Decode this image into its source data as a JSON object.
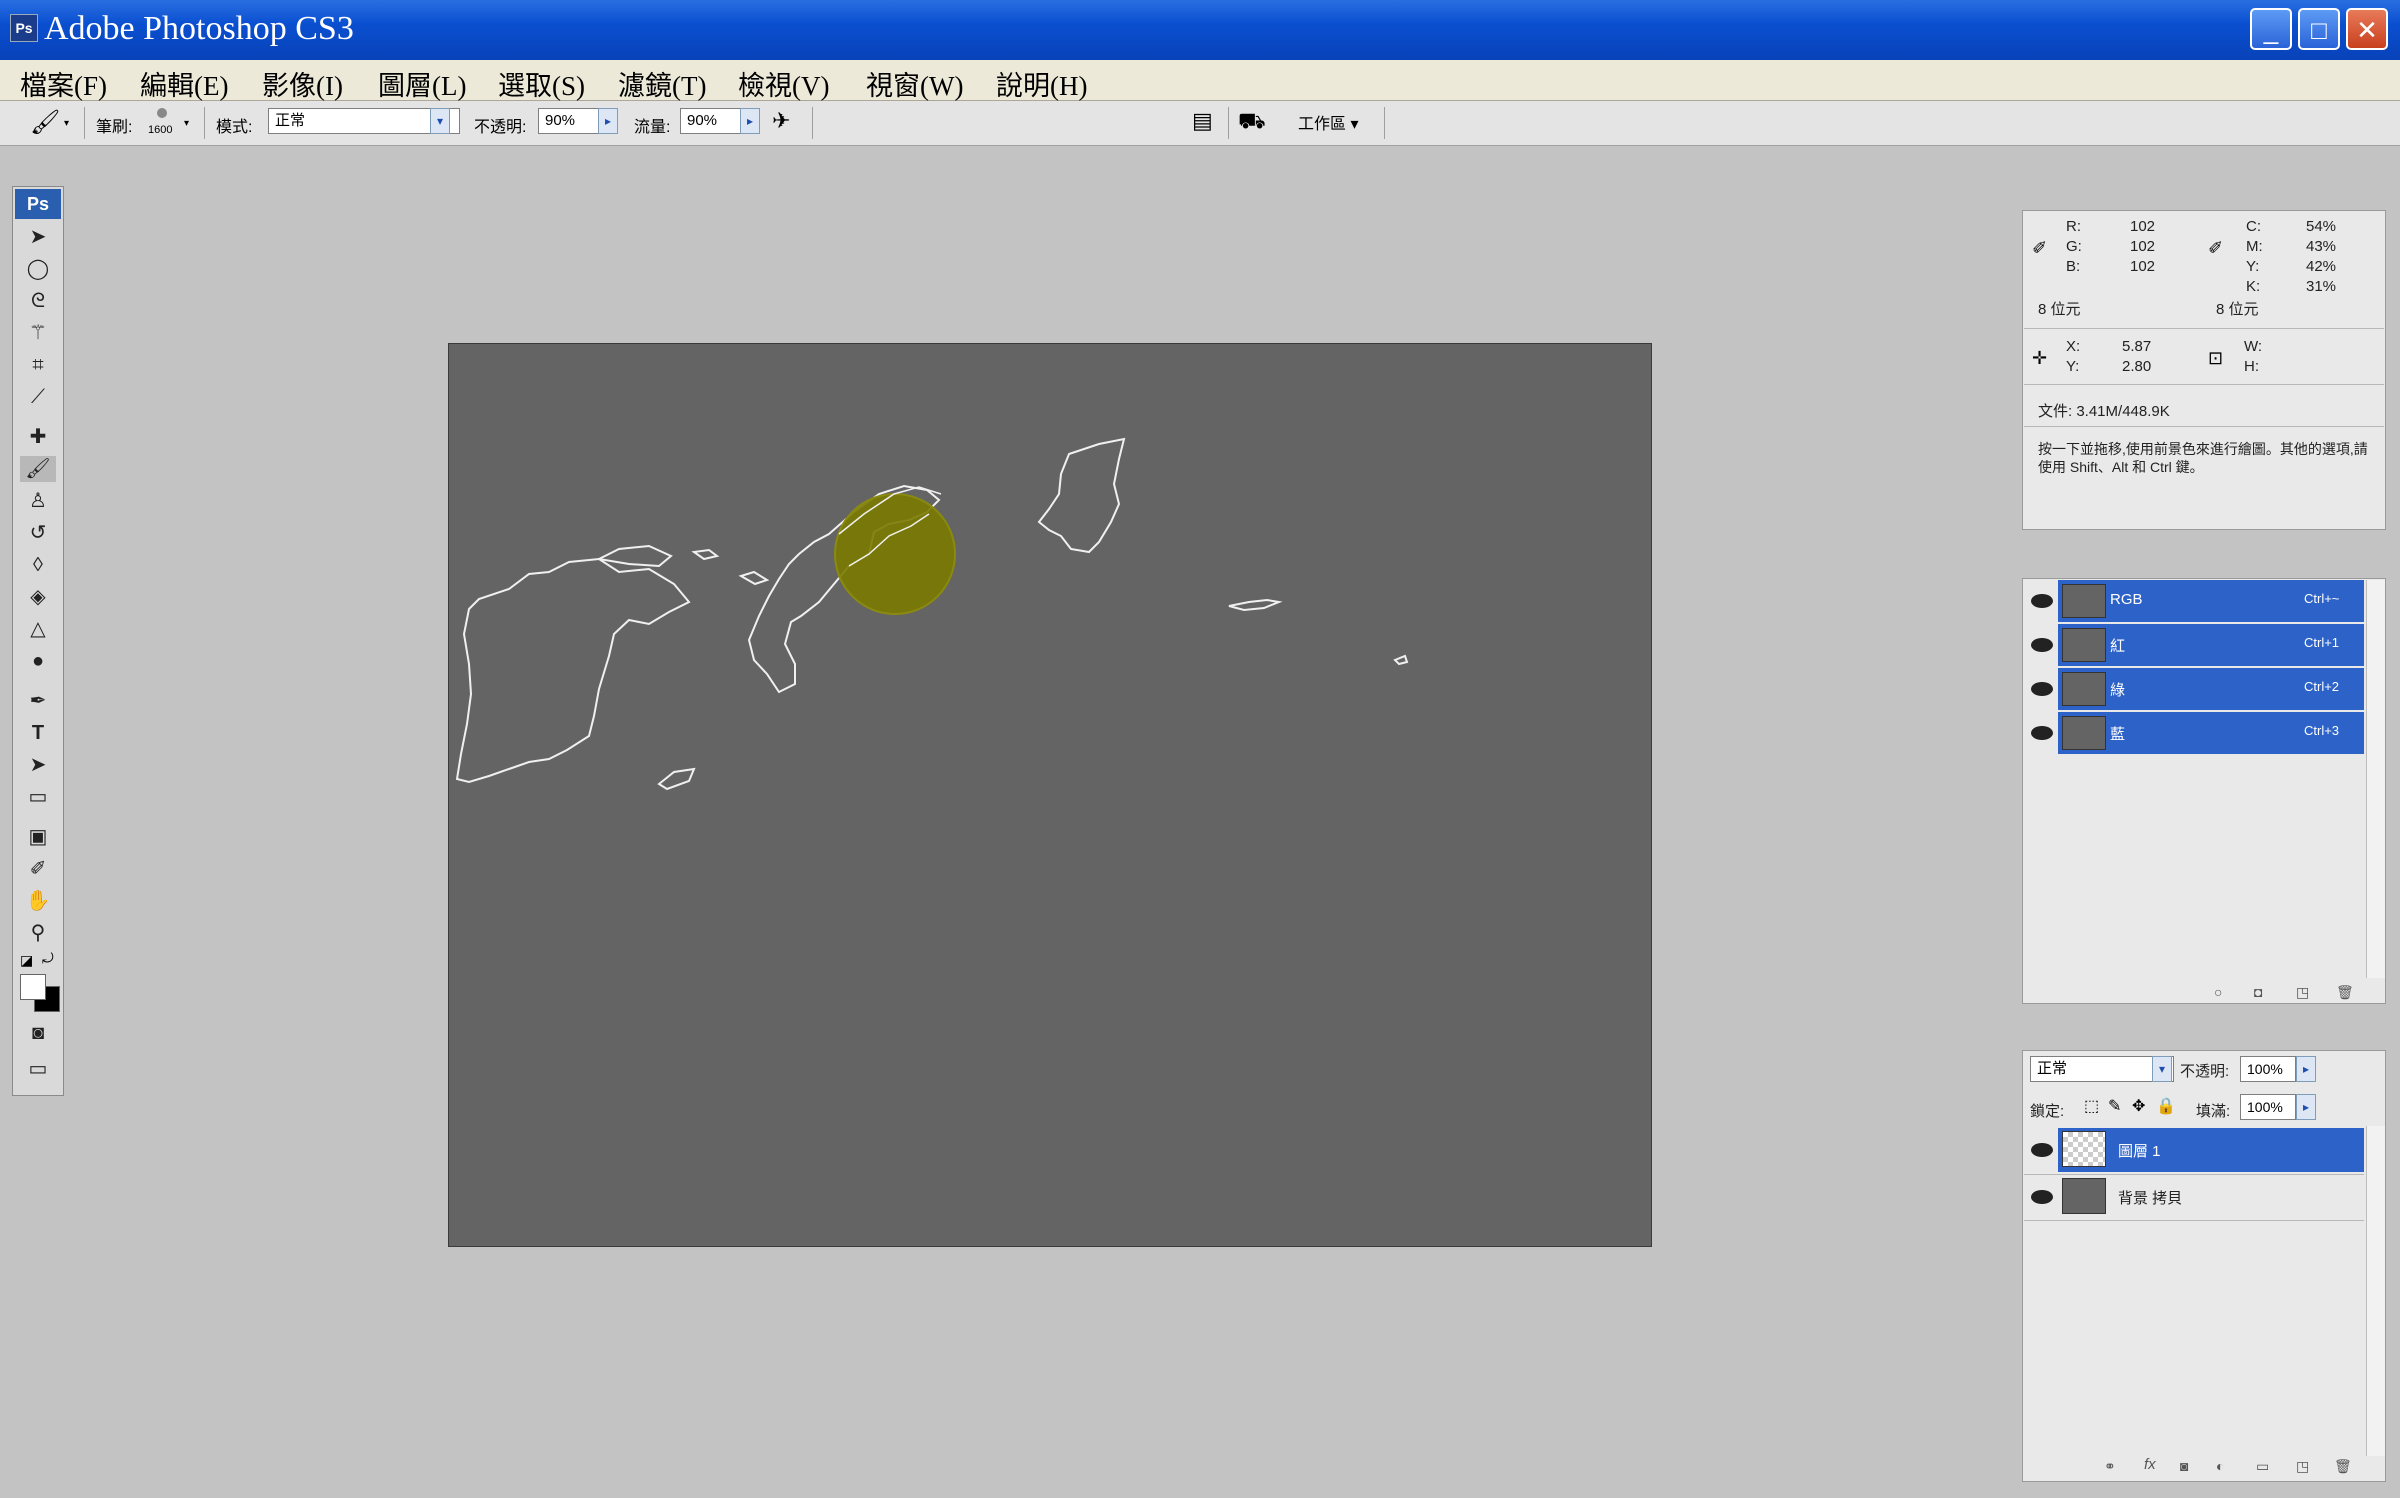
{
  "window": {
    "title": "Adobe Photoshop CS3",
    "icon": "Ps",
    "minimize": "_",
    "maximize": "□",
    "close": "✕"
  },
  "menu": [
    "檔案(F)",
    "編輯(E)",
    "影像(I)",
    "圖層(L)",
    "選取(S)",
    "濾鏡(T)",
    "檢視(V)",
    "視窗(W)",
    "說明(H)"
  ],
  "options": {
    "brush_label": "筆刷:",
    "brush_size": "1600",
    "mode_label": "模式:",
    "mode_value": "正常",
    "opacity_label": "不透明:",
    "opacity_value": "90%",
    "flow_label": "流量:",
    "flow_value": "90%",
    "workspace_label": "工作區 ▾"
  },
  "toolbox": {
    "logo": "Ps"
  },
  "info": {
    "rgb_labels": [
      "R:",
      "G:",
      "B:"
    ],
    "rgb_values": [
      "102",
      "102",
      "102"
    ],
    "cmyk_labels": [
      "C:",
      "M:",
      "Y:",
      "K:"
    ],
    "cmyk_values": [
      "54%",
      "43%",
      "42%",
      "31%"
    ],
    "bit_left": "8 位元",
    "bit_right": "8 位元",
    "xy_labels": [
      "X:",
      "Y:"
    ],
    "xy_values": [
      "5.87",
      "2.80"
    ],
    "wh_labels": [
      "W:",
      "H:"
    ],
    "doc": "文件: 3.41M/448.9K",
    "hint": "按一下並拖移,使用前景色來進行繪圖。其他的選項,請使用 Shift、Alt 和 Ctrl 鍵。"
  },
  "channels": [
    {
      "name": "RGB",
      "shortcut": "Ctrl+~"
    },
    {
      "name": "紅",
      "shortcut": "Ctrl+1"
    },
    {
      "name": "綠",
      "shortcut": "Ctrl+2"
    },
    {
      "name": "藍",
      "shortcut": "Ctrl+3"
    }
  ],
  "layers_panel": {
    "blend_mode": "正常",
    "opacity_label": "不透明:",
    "opacity_value": "100%",
    "lock_label": "鎖定:",
    "fill_label": "填滿:",
    "fill_value": "100%",
    "layers": [
      {
        "name": "圖層 1",
        "selected": true
      },
      {
        "name": "背景 拷貝",
        "selected": false
      }
    ]
  },
  "colors": {
    "title_bar": "#0a4fd0",
    "selection": "#2d63c8",
    "canvas": "#646464",
    "brush_cursor": "#7a7a00",
    "outline": "#f0f0f0"
  }
}
